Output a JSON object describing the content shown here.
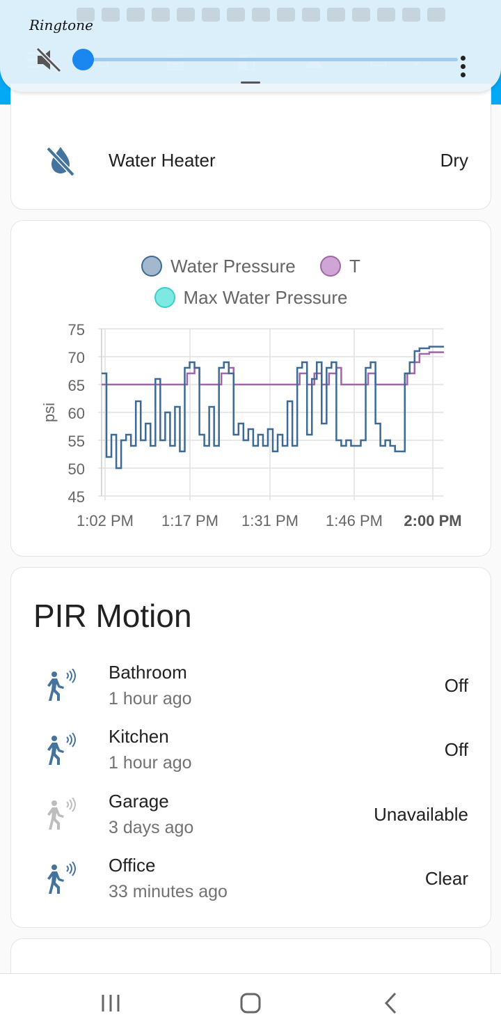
{
  "volume_overlay": {
    "title": "Ringtone",
    "level": 0.0
  },
  "water_card": {
    "rows": [
      {
        "name": "Water Heater",
        "state": "Dry",
        "icon": "water-off-icon"
      }
    ]
  },
  "chart_data": {
    "type": "line",
    "title": "",
    "ylabel": "psi",
    "xlabel": "",
    "ylim": [
      45,
      75
    ],
    "yticks": [
      75,
      70,
      65,
      60,
      55,
      50,
      45
    ],
    "xticks": [
      "1:02 PM",
      "1:17 PM",
      "1:31 PM",
      "1:46 PM",
      "2:00 PM"
    ],
    "legend": [
      "Water Pressure",
      "T",
      "Max Water Pressure"
    ],
    "legend_colors": [
      "#a3b7cf",
      "#cfa5d6",
      "#7ee8e3"
    ],
    "series": [
      {
        "name": "Water Pressure",
        "color": "#3c6a94",
        "points": [
          [
            0,
            67
          ],
          [
            1,
            52
          ],
          [
            2,
            56
          ],
          [
            3,
            50
          ],
          [
            4,
            55
          ],
          [
            5,
            56
          ],
          [
            6,
            54
          ],
          [
            7,
            62
          ],
          [
            8,
            55
          ],
          [
            9,
            58
          ],
          [
            10,
            54
          ],
          [
            11,
            66
          ],
          [
            12,
            55
          ],
          [
            13,
            60
          ],
          [
            14,
            54
          ],
          [
            15,
            61
          ],
          [
            16,
            53
          ],
          [
            17,
            68
          ],
          [
            18,
            69
          ],
          [
            19,
            68
          ],
          [
            20,
            56
          ],
          [
            21,
            54
          ],
          [
            22,
            61
          ],
          [
            23,
            54
          ],
          [
            24,
            68
          ],
          [
            25,
            69
          ],
          [
            26,
            67
          ],
          [
            27,
            56
          ],
          [
            28,
            58
          ],
          [
            29,
            55
          ],
          [
            30,
            57
          ],
          [
            31,
            54
          ],
          [
            32,
            56
          ],
          [
            33,
            54
          ],
          [
            34,
            57
          ],
          [
            35,
            53
          ],
          [
            36,
            56
          ],
          [
            37,
            54
          ],
          [
            38,
            62
          ],
          [
            39,
            54
          ],
          [
            40,
            68
          ],
          [
            41,
            69
          ],
          [
            42,
            56
          ],
          [
            43,
            66
          ],
          [
            44,
            69
          ],
          [
            45,
            58
          ],
          [
            46,
            68
          ],
          [
            47,
            69
          ],
          [
            48,
            55
          ],
          [
            49,
            54
          ],
          [
            50,
            55
          ],
          [
            51,
            54
          ],
          [
            52,
            54
          ],
          [
            53,
            55
          ],
          [
            54,
            68
          ],
          [
            55,
            69
          ],
          [
            56,
            58
          ],
          [
            57,
            54
          ],
          [
            58,
            55
          ],
          [
            59,
            54
          ],
          [
            60,
            53
          ],
          [
            61,
            53
          ],
          [
            62,
            67
          ],
          [
            63,
            69
          ],
          [
            64,
            71
          ],
          [
            65,
            71.5
          ],
          [
            66,
            71.5
          ],
          [
            67,
            71.8
          ],
          [
            68,
            71.8
          ],
          [
            69,
            71.8
          ],
          [
            70,
            71.8
          ]
        ]
      },
      {
        "name": "T",
        "color": "#a066a8",
        "points": [
          [
            0,
            65
          ],
          [
            17,
            65
          ],
          [
            17.5,
            67
          ],
          [
            19,
            68
          ],
          [
            20,
            65
          ],
          [
            24,
            65
          ],
          [
            24.5,
            67
          ],
          [
            26,
            68
          ],
          [
            27,
            65
          ],
          [
            40,
            65
          ],
          [
            40.5,
            67
          ],
          [
            42,
            65
          ],
          [
            43,
            65
          ],
          [
            43.5,
            67
          ],
          [
            45,
            65
          ],
          [
            46,
            65
          ],
          [
            46.5,
            67
          ],
          [
            48,
            68
          ],
          [
            49,
            65
          ],
          [
            54,
            65
          ],
          [
            54.5,
            67
          ],
          [
            56,
            65
          ],
          [
            62,
            65
          ],
          [
            62.5,
            67
          ],
          [
            64,
            69
          ],
          [
            65,
            70.5
          ],
          [
            66,
            70.5
          ],
          [
            67,
            70.8
          ],
          [
            68,
            70.8
          ],
          [
            69,
            70.8
          ],
          [
            70,
            70.8
          ]
        ]
      }
    ]
  },
  "pir_card": {
    "title": "PIR Motion",
    "rows": [
      {
        "name": "Bathroom",
        "secondary": "1 hour ago",
        "state": "Off",
        "icon": "motion-sensor-icon",
        "available": true
      },
      {
        "name": "Kitchen",
        "secondary": "1 hour ago",
        "state": "Off",
        "icon": "motion-sensor-icon",
        "available": true
      },
      {
        "name": "Garage",
        "secondary": "3 days ago",
        "state": "Unavailable",
        "icon": "motion-sensor-icon",
        "available": false
      },
      {
        "name": "Office",
        "secondary": "33 minutes ago",
        "state": "Clear",
        "icon": "motion-sensor-icon",
        "available": true
      }
    ]
  },
  "colors": {
    "app_bar": "#03a9f4",
    "state_icon": "#44739e",
    "unavailable_icon": "#bdbdbd",
    "volume_accent": "#1a86ef"
  },
  "navbar": {
    "buttons": [
      "recent-apps",
      "home",
      "back"
    ]
  }
}
